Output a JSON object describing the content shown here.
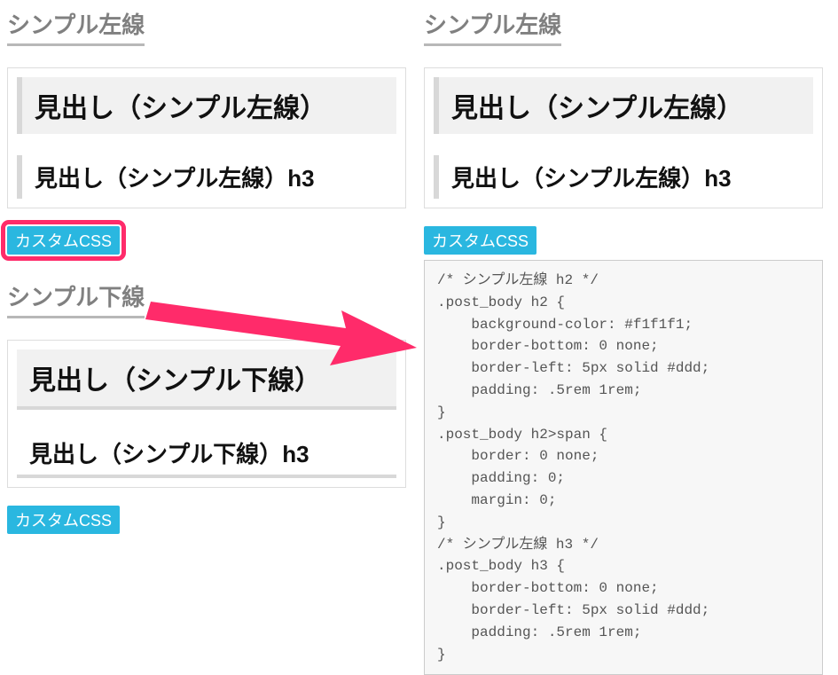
{
  "left": {
    "section1": {
      "title": "シンプル左線",
      "h2": "見出し（シンプル左線）",
      "h3": "見出し（シンプル左線）h3",
      "badge": "カスタムCSS"
    },
    "section2": {
      "title": "シンプル下線",
      "h2": "見出し（シンプル下線）",
      "h3": "見出し（シンプル下線）h3",
      "badge": "カスタムCSS"
    }
  },
  "right": {
    "section1": {
      "title": "シンプル左線",
      "h2": "見出し（シンプル左線）",
      "h3": "見出し（シンプル左線）h3",
      "badge": "カスタムCSS",
      "code": "/* シンプル左線 h2 */\n.post_body h2 {\n    background-color: #f1f1f1;\n    border-bottom: 0 none;\n    border-left: 5px solid #ddd;\n    padding: .5rem 1rem;\n}\n.post_body h2>span {\n    border: 0 none;\n    padding: 0;\n    margin: 0;\n}\n/* シンプル左線 h3 */\n.post_body h3 {\n    border-bottom: 0 none;\n    border-left: 5px solid #ddd;\n    padding: .5rem 1rem;\n}"
    }
  }
}
